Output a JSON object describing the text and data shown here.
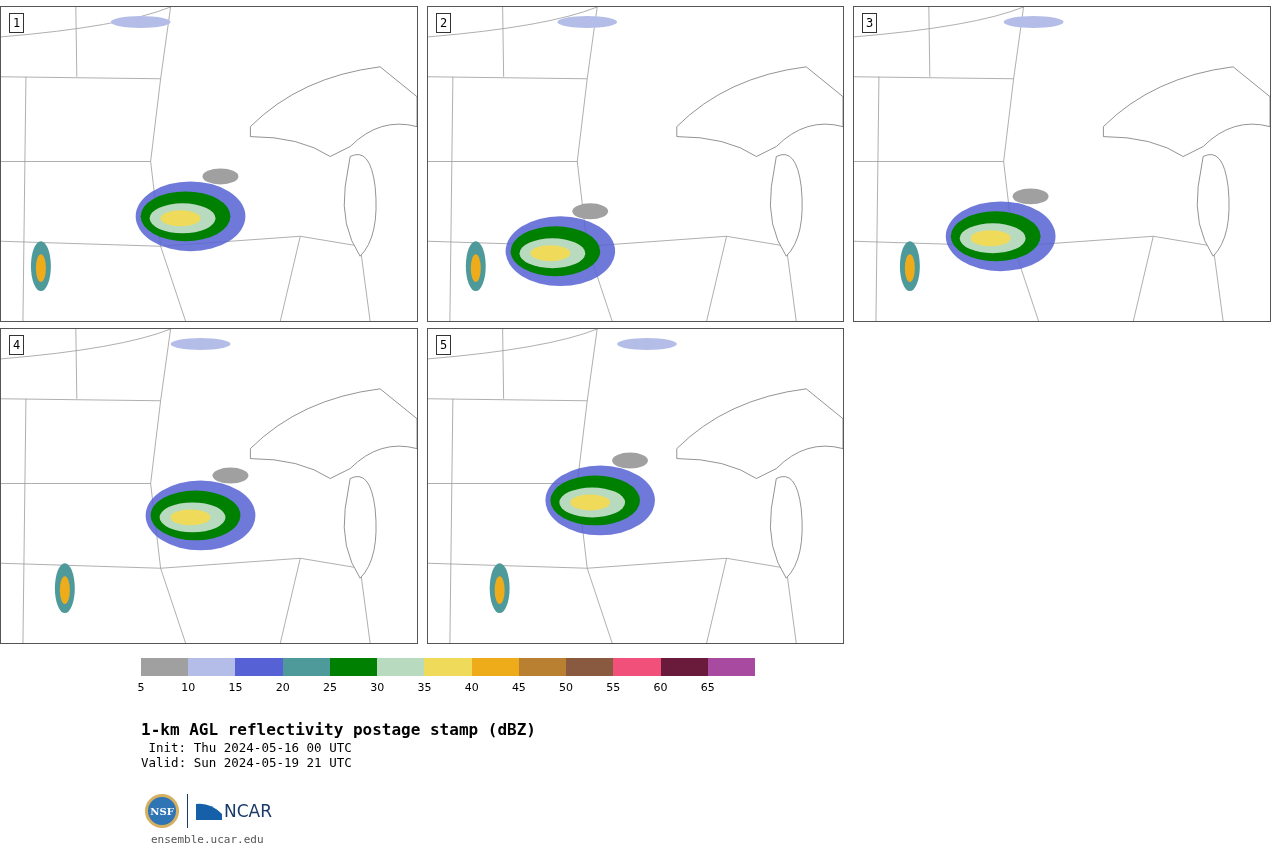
{
  "panels": [
    {
      "label": "1"
    },
    {
      "label": "2"
    },
    {
      "label": "3"
    },
    {
      "label": "4"
    },
    {
      "label": "5"
    }
  ],
  "colorbar": {
    "segments": [
      {
        "color": "#a0a0a0",
        "tick": "5"
      },
      {
        "color": "#b4bde8",
        "tick": "10"
      },
      {
        "color": "#5561d4",
        "tick": "15"
      },
      {
        "color": "#4e9a9a",
        "tick": "20"
      },
      {
        "color": "#008000",
        "tick": "25"
      },
      {
        "color": "#b8dbbf",
        "tick": "30"
      },
      {
        "color": "#f0da5a",
        "tick": "35"
      },
      {
        "color": "#eeab1a",
        "tick": "40"
      },
      {
        "color": "#b88030",
        "tick": "45"
      },
      {
        "color": "#8a5a40",
        "tick": "50"
      },
      {
        "color": "#f0507a",
        "tick": "55"
      },
      {
        "color": "#6a1a3a",
        "tick": "60"
      },
      {
        "color": "#a84aa0",
        "tick": "65"
      }
    ]
  },
  "title": "1-km AGL reflectivity postage stamp (dBZ)",
  "init": "Init: Thu 2024-05-16 00 UTC",
  "valid": "Valid: Sun 2024-05-19 21 UTC",
  "logos": {
    "nsf": "NSF",
    "ncar": "NCAR"
  },
  "url": "ensemble.ucar.edu"
}
